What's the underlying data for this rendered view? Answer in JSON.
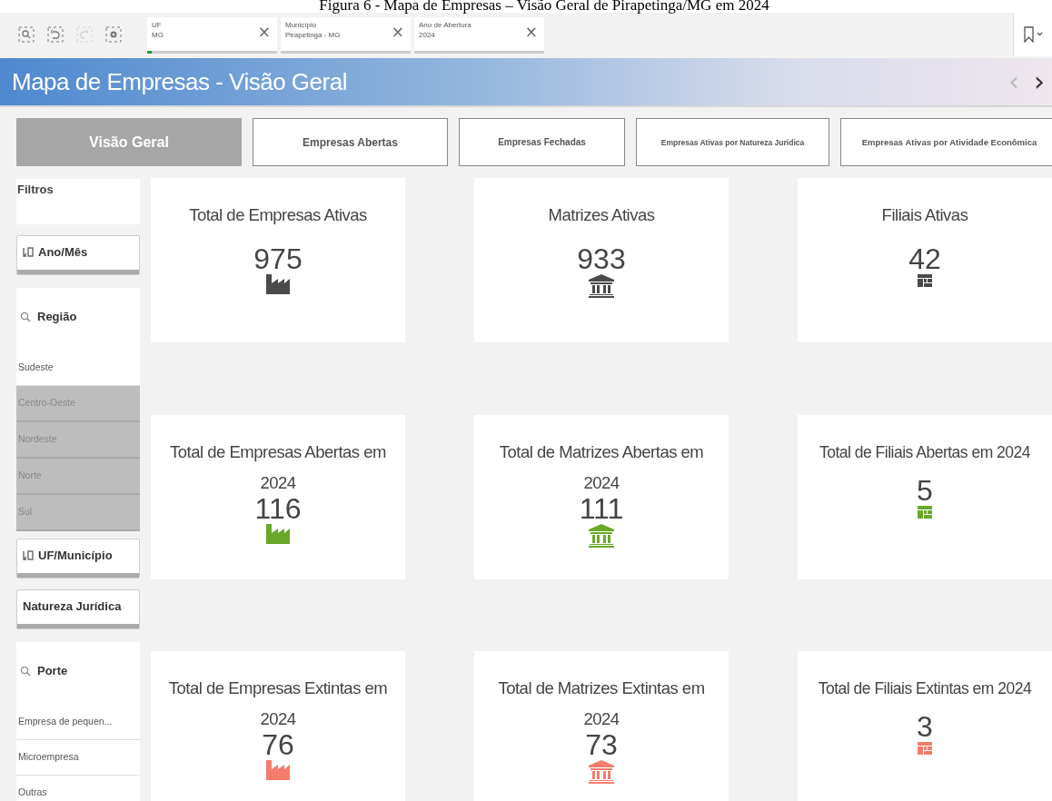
{
  "caption": "Figura 6 - Mapa de Empresas – Visão Geral de Pirapetinga/MG em 2024",
  "toolbar": {
    "tools": [
      {
        "kind": "search",
        "disabled": false
      },
      {
        "kind": "back",
        "disabled": false
      },
      {
        "kind": "forward",
        "disabled": true
      },
      {
        "kind": "clear",
        "disabled": false
      }
    ],
    "selections": [
      {
        "field": "UF",
        "value": "MG",
        "close": "×"
      },
      {
        "field": "Município",
        "value": "Pirapetinga - MG",
        "close": "×"
      },
      {
        "field": "Ano de Abertura",
        "value": "2024",
        "close": "×"
      }
    ]
  },
  "header": {
    "title": "Mapa de Empresas - Visão Geral",
    "prev": "‹",
    "next": "›"
  },
  "tabs": [
    {
      "label": "Visão Geral",
      "selected": true
    },
    {
      "label": "Empresas Abertas",
      "selected": false
    },
    {
      "label": "Empresas Fechadas",
      "selected": false
    },
    {
      "label": "Empresas Ativas por Natureza Jurídica",
      "selected": false
    },
    {
      "label": "Empresas Ativas por Atividade Econômica",
      "selected": false
    }
  ],
  "filters": [
    {
      "kind": "title",
      "label": "Filtros"
    },
    {
      "kind": "box",
      "label": "Ano/Mês",
      "drilldown": true
    },
    {
      "kind": "list",
      "label": "Região",
      "items": [
        {
          "label": "Sudeste",
          "excluded": false
        },
        {
          "label": "Centro-Oeste",
          "excluded": true
        },
        {
          "label": "Nordeste",
          "excluded": true
        },
        {
          "label": "Norte",
          "excluded": true
        },
        {
          "label": "Sul",
          "excluded": true
        }
      ]
    },
    {
      "kind": "box",
      "label": "UF/Município",
      "drilldown": true
    },
    {
      "kind": "box",
      "label": "Natureza Jurídica",
      "drilldown": false
    },
    {
      "kind": "list",
      "label": "Porte",
      "items": [
        {
          "label": "Empresa de pequen...",
          "excluded": false
        },
        {
          "label": "Microempresa",
          "excluded": false
        },
        {
          "label": "Outras",
          "excluded": false
        }
      ]
    }
  ],
  "kpis": [
    {
      "title": "Total de Empresas Ativas",
      "value": "975",
      "kind": "factory",
      "color": "#4a4a4a"
    },
    {
      "title": "Matrizes Ativas",
      "value": "933",
      "kind": "bank",
      "color": "#4a4a4a"
    },
    {
      "title": "Filiais Ativas",
      "value": "42",
      "kind": "grid",
      "color": "#4a4a4a"
    },
    {
      "title": "Total de Empresas Abertas em 2024",
      "value": "116",
      "kind": "factory",
      "color": "#6aa829"
    },
    {
      "title": "Total de Matrizes Abertas em 2024",
      "value": "111",
      "kind": "bank",
      "color": "#6aa829"
    },
    {
      "title": "Total de Filiais Abertas em 2024",
      "value": "5",
      "kind": "grid",
      "color": "#6aa829"
    },
    {
      "title": "Total de Empresas Extintas em 2024",
      "value": "76",
      "kind": "factory",
      "color": "#f47c6c"
    },
    {
      "title": "Total de Matrizes Extintas em 2024",
      "value": "73",
      "kind": "bank",
      "color": "#f47c6c"
    },
    {
      "title": "Total de Filiais Extintas em 2024",
      "value": "3",
      "kind": "grid",
      "color": "#f47c6c"
    }
  ]
}
